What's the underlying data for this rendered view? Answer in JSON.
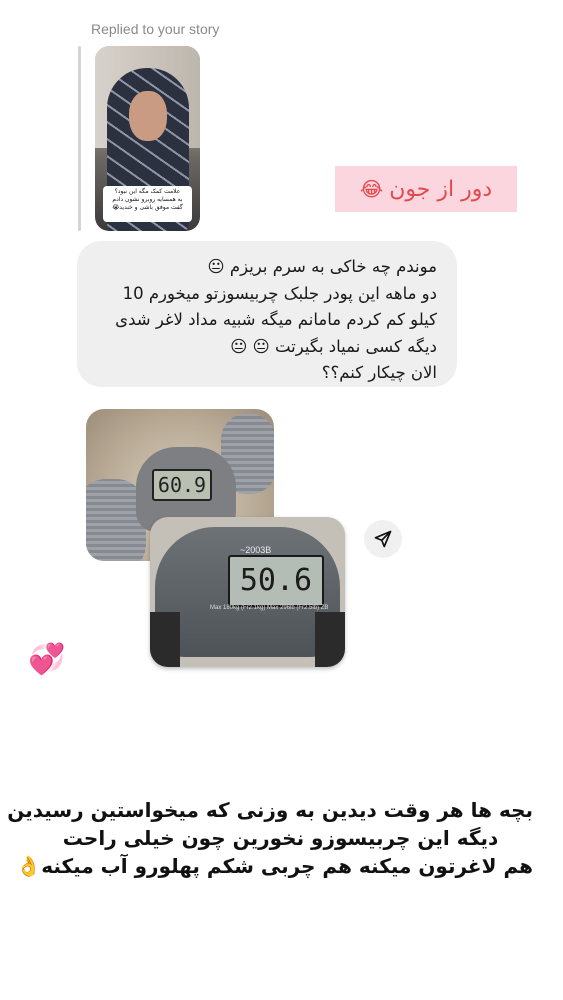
{
  "reply_header": {
    "label": "Replied to your story"
  },
  "story_thumbnail": {
    "sticker_lines": [
      "علامت کمک مگه این نبود؟",
      "به همسایه روبرو نشون دادم",
      "گفت موفق باشی و خندید😭"
    ]
  },
  "laugh_reply": {
    "text": "دور از جون",
    "emoji": "😂",
    "text_color": "#e5484d",
    "background": "#fbd6df"
  },
  "message_bubble": {
    "lines": [
      "موندم چه خاکی به سرم بریزم 😐",
      "دو ماهه این پودر جلبک چربیسوزتو میخورم 10",
      "کیلو کم کردم مامانم میگه شبیه مداد لاغر شدی",
      "دیگه کسی نمیاد بگیرتت 😐 😐",
      "الان چیکار کنم؟؟"
    ]
  },
  "photo_before": {
    "display_reading": "60.9"
  },
  "photo_after": {
    "brand": "~2003B",
    "display_reading": "50.6",
    "spec_text": "Max 180kg (Fr2.1kg) Max 296lb (Fr2.5lb) ZB"
  },
  "share_button": {
    "icon": "send-icon"
  },
  "reaction": {
    "emoji": "💞"
  },
  "caption": {
    "lines": [
      "بچه ها هر وقت دیدین به وزنی که میخواستین رسیدین",
      "دیگه این چربیسوزو نخورین چون خیلی راحت",
      "هم لاغرتون میکنه هم چربی شکم پهلورو آب میکنه👌"
    ]
  }
}
